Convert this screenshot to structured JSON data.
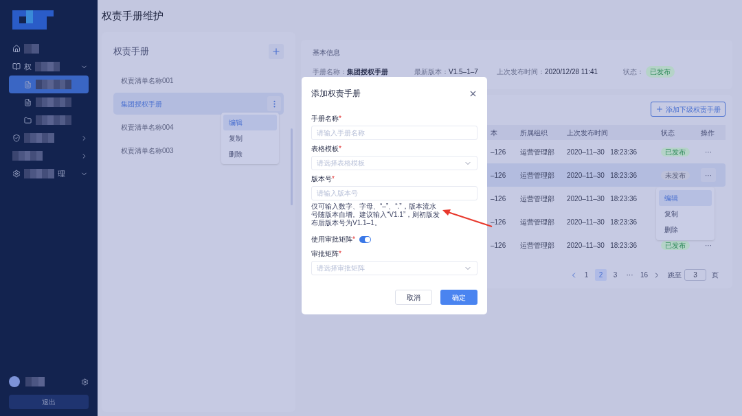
{
  "page_title": "权责手册维护",
  "sidebar": {
    "items": [
      {
        "kind": "link"
      },
      {
        "kind": "group",
        "label": "权",
        "expanded": true,
        "children": [
          {
            "selected": true
          },
          {
            "selected": false
          },
          {
            "selected": false
          }
        ]
      },
      {
        "kind": "group",
        "expanded": false
      },
      {
        "kind": "group",
        "expanded": false
      },
      {
        "kind": "group",
        "label_end": "理",
        "expanded": true
      }
    ],
    "logout": "退出"
  },
  "handbook_panel": {
    "title": "权责手册",
    "items": [
      {
        "label": "权责清单名称001",
        "selected": false
      },
      {
        "label": "集团授权手册",
        "selected": true
      },
      {
        "label": "权责清单名称004",
        "selected": false
      },
      {
        "label": "权责清单名称003",
        "selected": false
      }
    ],
    "menu": [
      {
        "label": "编辑",
        "selected": true
      },
      {
        "label": "复制",
        "selected": false
      },
      {
        "label": "删除",
        "selected": false
      }
    ]
  },
  "basic_info": {
    "title": "基本信息",
    "fields": [
      {
        "label": "手册名称：",
        "value": "集团授权手册"
      },
      {
        "label": "最新版本：",
        "value": "V1.5–1–7"
      },
      {
        "label": "上次发布时间：",
        "value": "2020/12/28  11:41"
      }
    ],
    "status_label": "状态：",
    "status": "已发布"
  },
  "table": {
    "add_button": "添加下级权责手册",
    "columns": [
      "本",
      "所属组织",
      "上次发布时间",
      "状态",
      "操作"
    ],
    "rows": [
      {
        "version": "–126",
        "org": "运营管理部",
        "date": "2020–11–30",
        "time": "18:23:36",
        "status": {
          "text": "已发布",
          "kind": "published"
        },
        "actions": "···",
        "selected": false
      },
      {
        "version": "–126",
        "org": "运营管理部",
        "date": "2020–11–30",
        "time": "18:23:36",
        "status": {
          "text": "未发布",
          "kind": "draft"
        },
        "actions": "···",
        "selected": true
      },
      {
        "version": "–126",
        "org": "运营管理部",
        "date": "2020–11–30",
        "time": "18:23:36",
        "selected": false
      },
      {
        "version": "–126",
        "org": "运营管理部",
        "date": "2020–11–30",
        "time": "18:23:36",
        "selected": false
      },
      {
        "version": "–126",
        "org": "运营管理部",
        "date": "2020–11–30",
        "time": "18:23:36",
        "status": {
          "text": "已发布",
          "kind": "published"
        },
        "actions": "···",
        "selected": false
      }
    ],
    "row_menu": [
      {
        "label": "编辑",
        "selected": true
      },
      {
        "label": "复制",
        "selected": false
      },
      {
        "label": "删除",
        "selected": false
      }
    ],
    "pagination": {
      "pages": [
        {
          "label": "1",
          "selected": false
        },
        {
          "label": "2",
          "selected": true
        },
        {
          "label": "3",
          "selected": false
        },
        {
          "label": "···",
          "selected": false
        },
        {
          "label": "16",
          "selected": false
        }
      ],
      "jump_label": "跳至",
      "jump_value": "3",
      "unit": "页"
    }
  },
  "modal": {
    "title": "添加权责手册",
    "fields": [
      {
        "kind": "input",
        "label": "手册名称",
        "mark": "*",
        "placeholder": "请输入手册名称"
      },
      {
        "kind": "select",
        "label": "表格模板",
        "mark": "*",
        "placeholder": "请选择表格模板"
      },
      {
        "kind": "input",
        "label": "版本号",
        "mark": "*",
        "placeholder": "请输入版本号",
        "hint": "仅可输入数字、字母、“–”、“.”，版本流水号随版本自增。建议输入“V1.1”，则初版发布后版本号为V1.1–1。"
      },
      {
        "kind": "switch",
        "label": "使用审批矩阵",
        "mark": "*",
        "on": true
      },
      {
        "kind": "select",
        "label": "审批矩阵",
        "mark": "*",
        "placeholder": "请选择审批矩阵"
      }
    ],
    "buttons": [
      {
        "label": "取消",
        "kind": "secondary"
      },
      {
        "label": "确定",
        "kind": "primary"
      }
    ]
  }
}
